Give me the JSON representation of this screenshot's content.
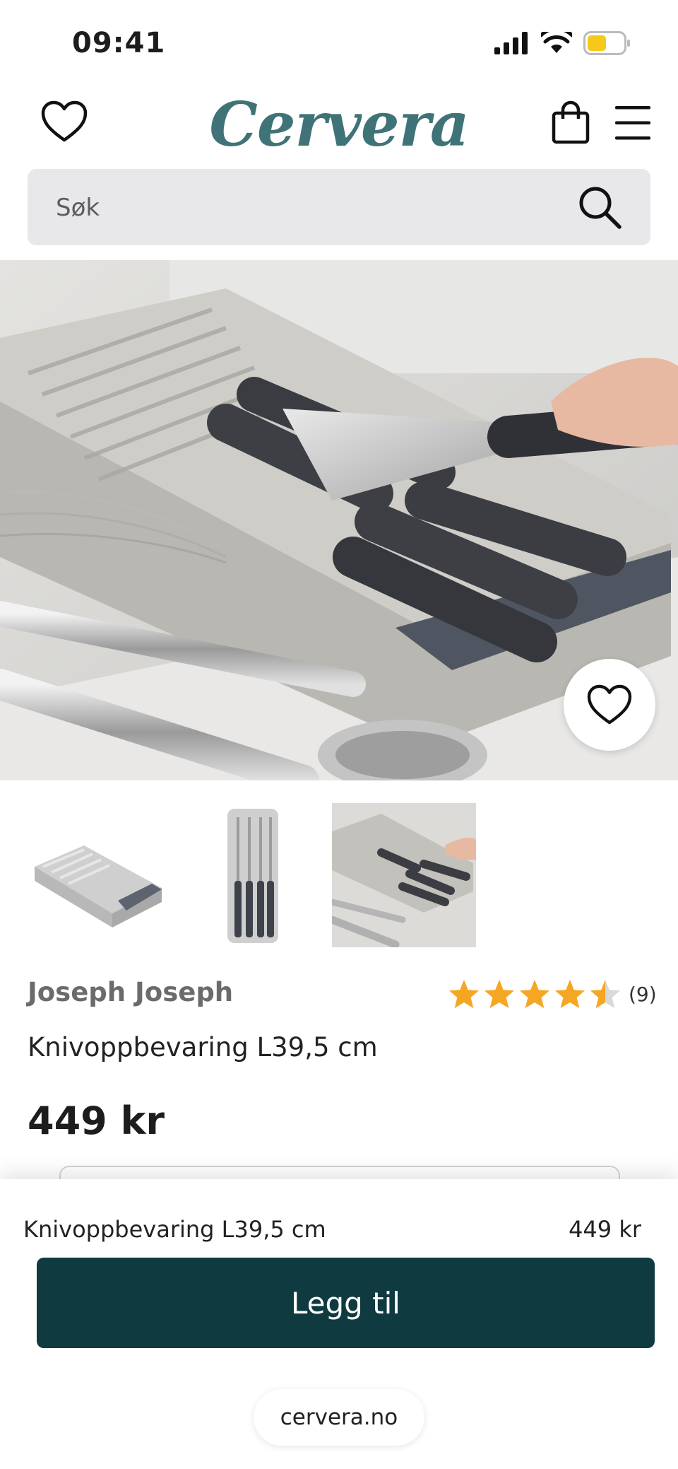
{
  "status_bar": {
    "time": "09:41"
  },
  "header": {
    "logo": "Cervera"
  },
  "search": {
    "placeholder": "Søk"
  },
  "product": {
    "brand": "Joseph Joseph",
    "name": "Knivoppbevaring L39,5 cm",
    "price": "449 kr",
    "rating_value": 4.5,
    "rating_count": "(9)",
    "thumbnails": [
      "thumbnail-tray-angled",
      "thumbnail-tray-topview",
      "thumbnail-tray-in-drawer"
    ]
  },
  "sticky_bar": {
    "name": "Knivoppbevaring L39,5 cm",
    "price": "449 kr",
    "add_label": "Legg til"
  },
  "browser": {
    "domain": "cervera.no"
  },
  "colors": {
    "brand": "#3f7377",
    "button": "#0f3b40",
    "star": "#f5a623"
  }
}
